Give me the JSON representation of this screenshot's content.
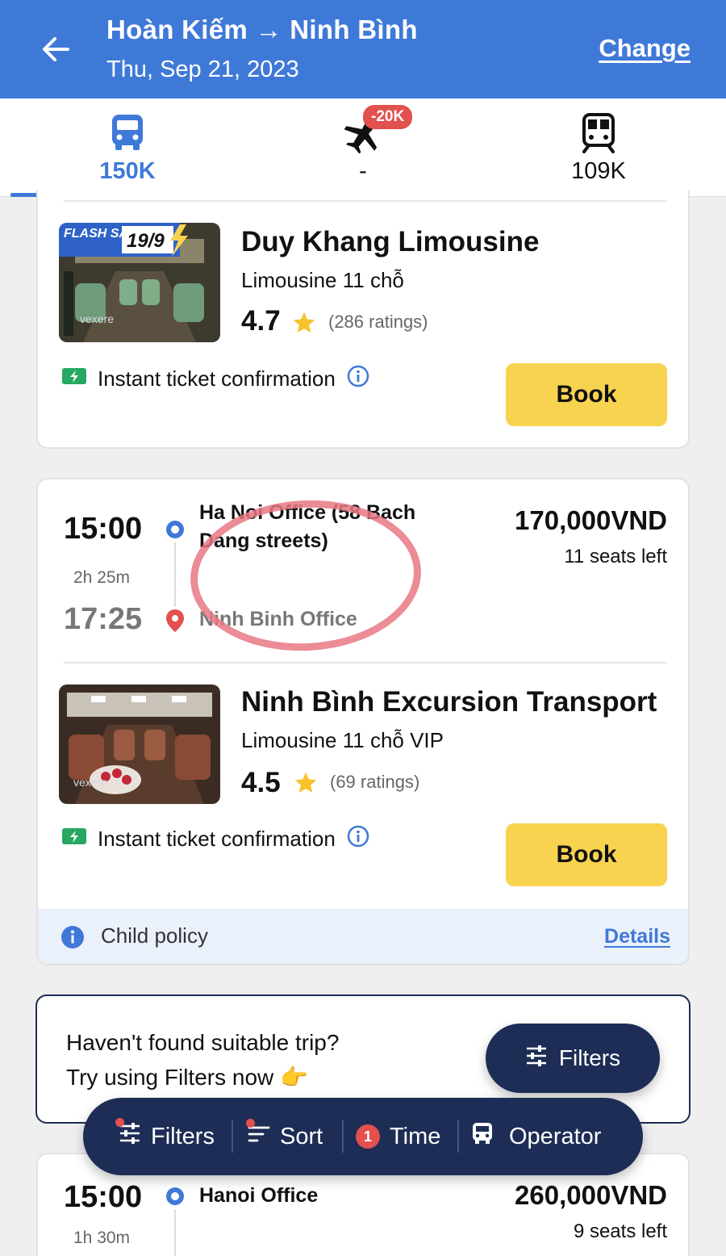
{
  "header": {
    "route": "Hoàn Kiếm → Ninh Bình",
    "date": "Thu, Sep 21, 2023",
    "change_label": "Change"
  },
  "tabs": [
    {
      "icon": "bus-icon",
      "label": "150K",
      "active": true
    },
    {
      "icon": "plane-icon",
      "label": "-",
      "badge": "-20K"
    },
    {
      "icon": "train-icon",
      "label": "109K"
    }
  ],
  "card1": {
    "promo_flash": "FLASH SALE",
    "promo_date": "19/9",
    "thumb_watermark": "vexere",
    "operator": "Duy Khang Limousine",
    "vehicle": "Limousine 11 chỗ",
    "rating": "4.7",
    "rating_count": "(286 ratings)",
    "instant": "Instant ticket confirmation",
    "book_label": "Book"
  },
  "card2": {
    "depart_time": "15:00",
    "duration": "2h 25m",
    "arrive_time": "17:25",
    "from_stop": "Ha Noi Office (58 Bach Dang streets)",
    "to_stop": "Ninh Binh Office",
    "price": "170,000VND",
    "seats": "11 seats left",
    "operator": "Ninh Bình Excursion Transport",
    "vehicle": "Limousine 11 chỗ VIP",
    "thumb_watermark": "vexere",
    "rating": "4.5",
    "rating_count": "(69 ratings)",
    "instant": "Instant ticket confirmation",
    "book_label": "Book",
    "child_policy": "Child policy",
    "details_label": "Details"
  },
  "suggest": {
    "line1": "Haven't found suitable trip?",
    "line2": "Try using Filters now 👉",
    "filters_label": "Filters"
  },
  "bottom_bar": {
    "filters": "Filters",
    "sort": "Sort",
    "time_count": "1",
    "time": "Time",
    "operator": "Operator"
  },
  "card3": {
    "depart_time": "15:00",
    "duration": "1h 30m",
    "from_stop": "Hanoi Office",
    "price": "260,000VND",
    "seats": "9 seats left"
  },
  "colors": {
    "primary": "#3f79d8",
    "book": "#f8d34f",
    "navy": "#1d2d55",
    "badge_red": "#e2514e",
    "instant_green": "#27a862"
  }
}
